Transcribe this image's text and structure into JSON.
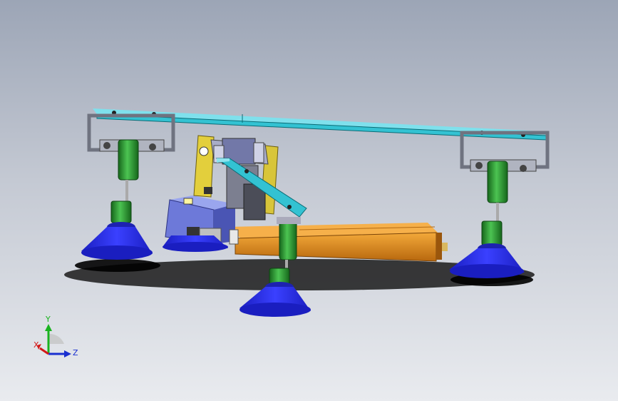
{
  "viewport": {
    "background_top": "#9ca5b6",
    "background_bottom": "#e9ebef"
  },
  "model": {
    "colors": {
      "crossbar": "#33c2d2",
      "bracket": "#6f7380",
      "cylinder": "#2f9a37",
      "suction_cup": "#2328e2",
      "body": "#d6871c",
      "block": "#6d79d9",
      "plate": "#d8c53a"
    }
  },
  "triad": {
    "x_label": "X",
    "y_label": "Y",
    "z_label": "Z",
    "x_color": "#d21818",
    "y_color": "#19b31f",
    "z_color": "#1a2fd0"
  }
}
